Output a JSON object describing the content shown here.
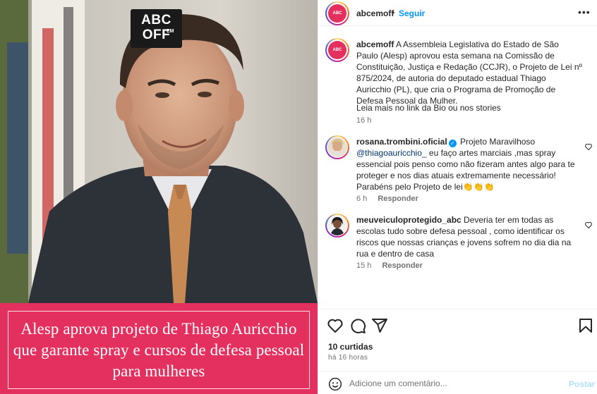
{
  "media": {
    "logo_line1": "ABC",
    "logo_line2": "OFF",
    "logo_small": "EM",
    "caption": "Alesp aprova projeto de Thiago Auricchio que garante spray e cursos de defesa pessoal para mulheres",
    "caption_bg": "#e4305e"
  },
  "header": {
    "username": "abcemoff",
    "separator": "•",
    "follow_label": "Seguir",
    "more_icon": "more-horizontal-icon"
  },
  "caption_post": {
    "username": "abcemoff",
    "text": "A Assembleia Legislativa do Estado de São Paulo (Alesp) aprovou esta semana na Comissão de Constituição, Justiça e Redação (CCJR), o Projeto de Lei nº 875/2024, de autoria do deputado estadual Thiago Auricchio (PL), que cria o Programa de Promoção de Defesa Pessoal da Mulher.",
    "more": "Leia mais no link da Bio ou nos stories",
    "time": "16 h"
  },
  "comments": [
    {
      "username": "rosana.trombini.oficial",
      "verified": true,
      "lead": "Projeto Maravilhoso",
      "mention": "@thiagoauricchio_",
      "text": " eu faço artes marciais ,mas spray essencial pois penso como não fizeram antes algo para te proteger e nos dias atuais extremamente necessário! Parabéns pelo Projeto de lei👏👏👏",
      "time": "6 h",
      "reply_label": "Responder"
    },
    {
      "username": "meuveiculoprotegido_abc",
      "verified": false,
      "text": "Deveria ter em todas as escolas tudo sobre defesa pessoal , como identificar os riscos que nossas crianças e jovens sofrem no dia dia na rua e dentro de casa",
      "time": "15 h",
      "reply_label": "Responder"
    }
  ],
  "actions": {
    "icons": [
      "heart-icon",
      "comment-icon",
      "share-icon",
      "bookmark-icon"
    ],
    "likes": "10 curtidas",
    "time": "há 16 horas"
  },
  "comment_box": {
    "placeholder": "Adicione um comentário...",
    "post_label": "Postar"
  }
}
